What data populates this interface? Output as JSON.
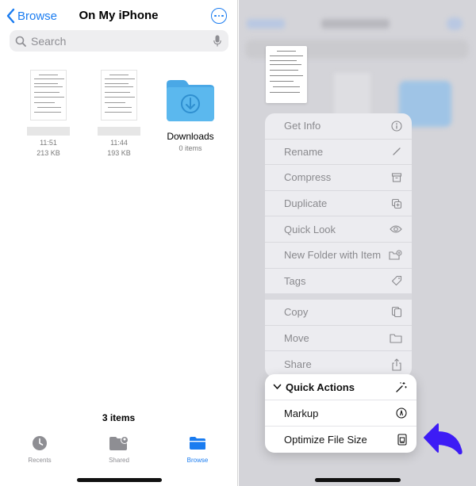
{
  "left": {
    "back_label": "Browse",
    "title": "On My iPhone",
    "search_placeholder": "Search",
    "files": [
      {
        "time": "11:51",
        "size": "213 KB"
      },
      {
        "time": "11:44",
        "size": "193 KB"
      }
    ],
    "folder": {
      "name": "Downloads",
      "count": "0 items"
    },
    "item_count": "3 items",
    "tabs": [
      {
        "label": "Recents",
        "icon": "clock-icon"
      },
      {
        "label": "Shared",
        "icon": "shared-folder-icon"
      },
      {
        "label": "Browse",
        "icon": "folder-icon",
        "active": true
      }
    ]
  },
  "right": {
    "menu_group1": [
      {
        "label": "Get Info",
        "icon": "info-icon"
      },
      {
        "label": "Rename",
        "icon": "pencil-icon"
      },
      {
        "label": "Compress",
        "icon": "archive-box-icon"
      },
      {
        "label": "Duplicate",
        "icon": "duplicate-icon"
      },
      {
        "label": "Quick Look",
        "icon": "eye-icon"
      },
      {
        "label": "New Folder with Item",
        "icon": "folder-plus-icon"
      },
      {
        "label": "Tags",
        "icon": "tag-icon"
      }
    ],
    "menu_group2": [
      {
        "label": "Copy",
        "icon": "copy-icon"
      },
      {
        "label": "Move",
        "icon": "folder-icon"
      },
      {
        "label": "Share",
        "icon": "share-icon"
      }
    ],
    "quick_actions": {
      "header": "Quick Actions",
      "items": [
        {
          "label": "Markup",
          "icon": "markup-icon"
        },
        {
          "label": "Optimize File Size",
          "icon": "optimize-file-icon"
        }
      ]
    }
  },
  "colors": {
    "accent": "#1a7cf0",
    "arrow": "#3d1cf5",
    "folder": "#5bb8ee"
  }
}
